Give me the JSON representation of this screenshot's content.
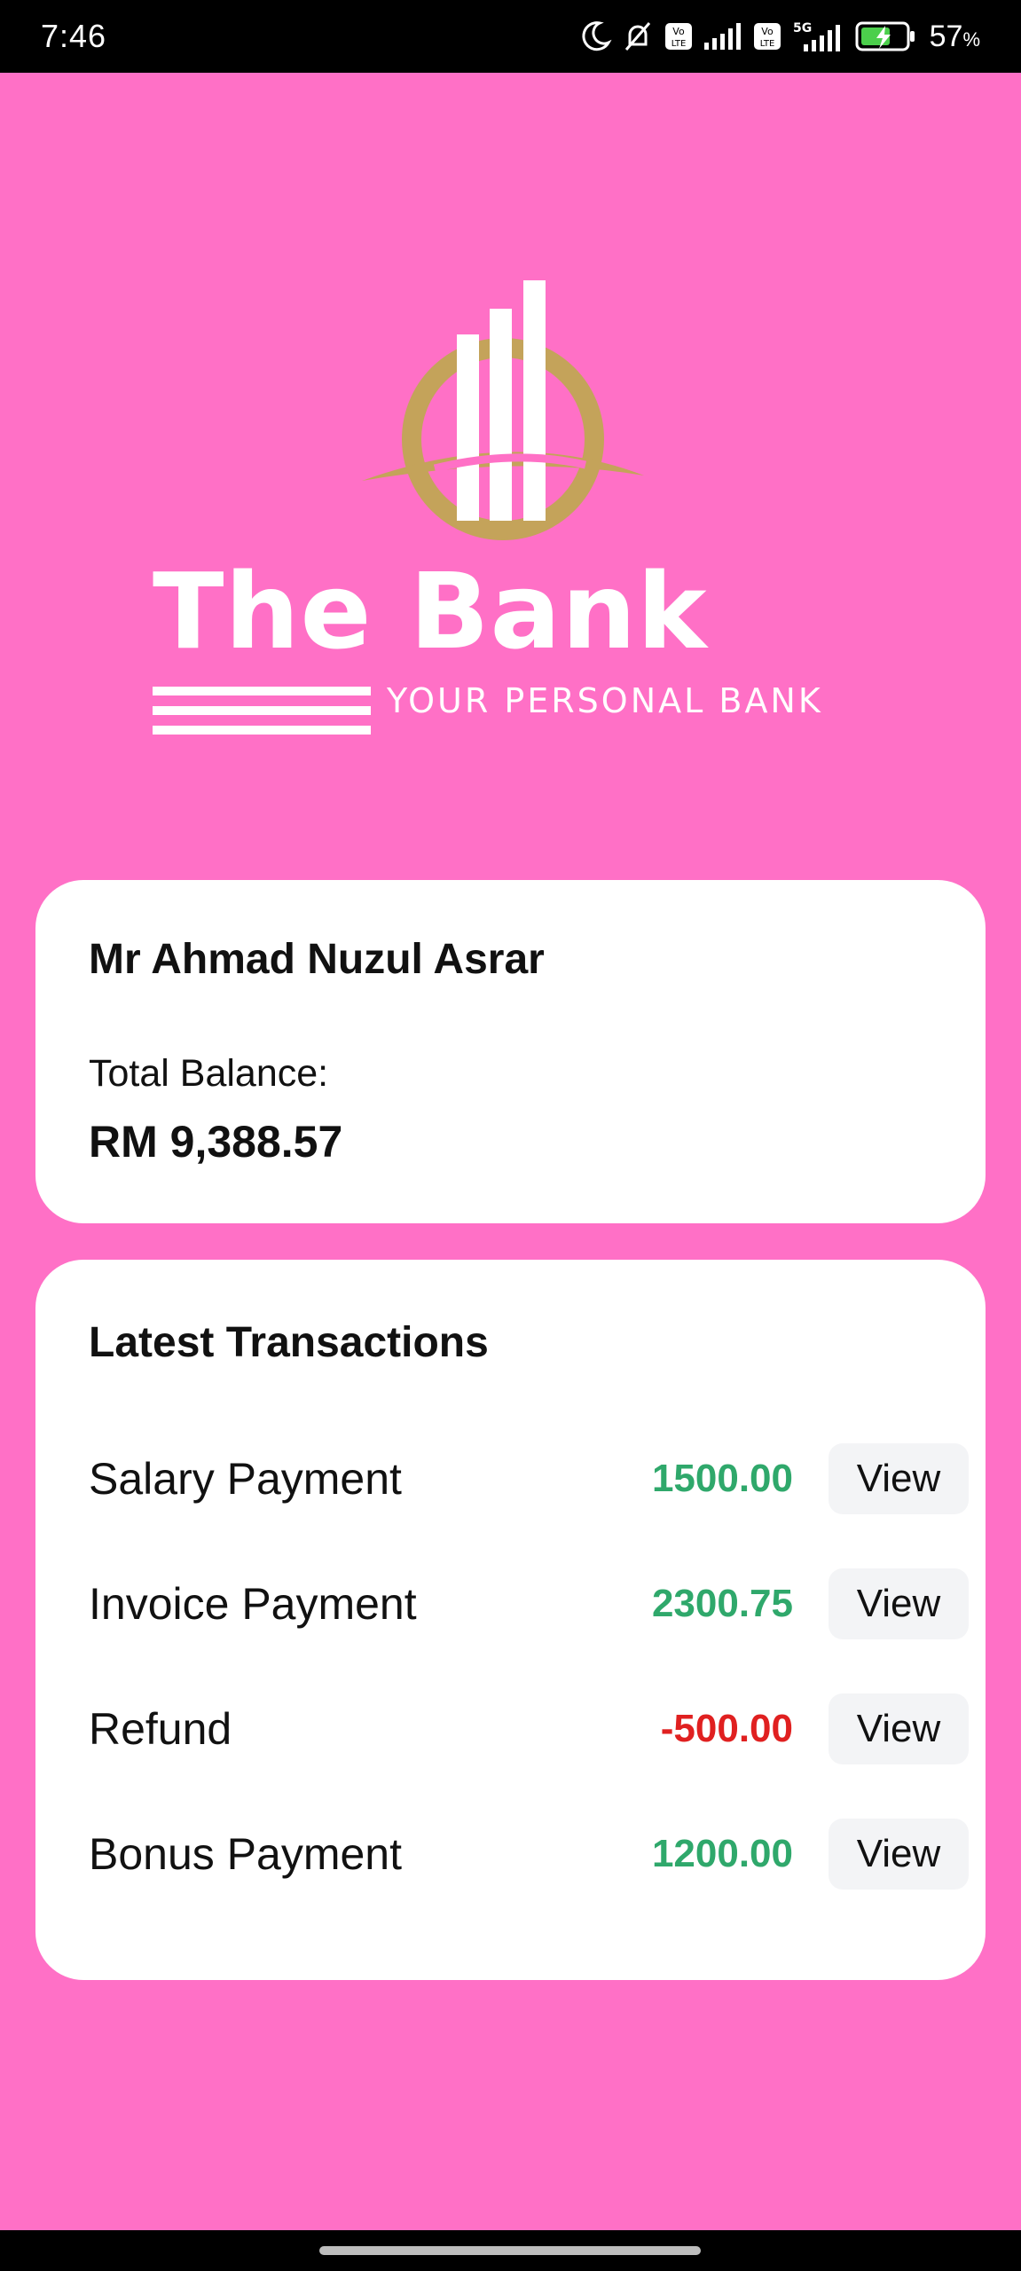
{
  "status_bar": {
    "time": "7:46",
    "icons": [
      "moon-icon",
      "bell-off-icon",
      "volte-icon",
      "signal-icon",
      "volte-icon",
      "5g-signal-icon",
      "battery-charging-icon"
    ],
    "battery_percent": "57",
    "battery_unit": "%"
  },
  "logo": {
    "title": "The Bank",
    "tagline": "YOUR PERSONAL BANK",
    "colors": {
      "ring": "#c4a35a",
      "bars": "#ffffff"
    }
  },
  "account": {
    "name": "Mr Ahmad Nuzul Asrar",
    "balance_label": "Total Balance:",
    "balance_value": "RM 9,388.57"
  },
  "transactions": {
    "title": "Latest Transactions",
    "items": [
      {
        "name": "Salary Payment",
        "amount": "1500.00",
        "type": "credit",
        "action": "View"
      },
      {
        "name": "Invoice Payment",
        "amount": "2300.75",
        "type": "credit",
        "action": "View"
      },
      {
        "name": "Refund",
        "amount": "-500.00",
        "type": "debit",
        "action": "View"
      },
      {
        "name": "Bonus Payment",
        "amount": "1200.00",
        "type": "credit",
        "action": "View"
      }
    ]
  },
  "colors": {
    "background": "#ff70c6",
    "positive": "#2fa86b",
    "negative": "#e02020",
    "card": "#ffffff"
  }
}
